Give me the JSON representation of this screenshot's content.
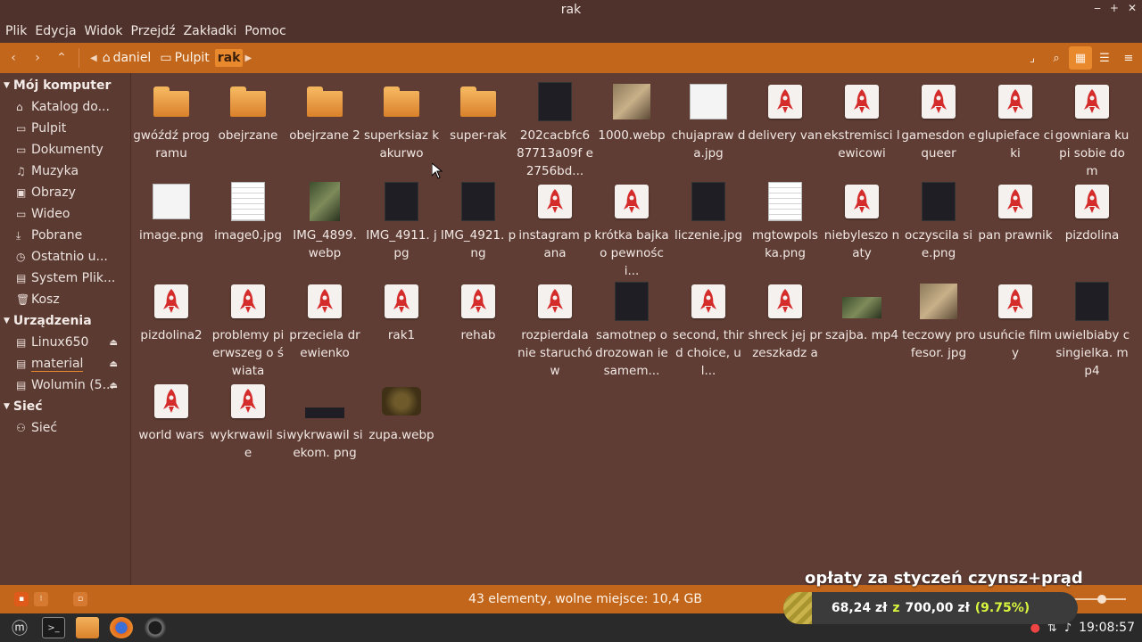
{
  "window": {
    "title": "rak"
  },
  "menu": [
    "Plik",
    "Edycja",
    "Widok",
    "Przejdź",
    "Zakładki",
    "Pomoc"
  ],
  "breadcrumb": [
    {
      "label": "daniel",
      "icon": "home-icon"
    },
    {
      "label": "Pulpit",
      "icon": "folder-icon"
    },
    {
      "label": "rak",
      "icon": ""
    }
  ],
  "sidebar": {
    "sections": [
      {
        "title": "Mój komputer",
        "items": [
          {
            "label": "Katalog do...",
            "icon": "home-icon"
          },
          {
            "label": "Pulpit",
            "icon": "folder-icon"
          },
          {
            "label": "Dokumenty",
            "icon": "folder-icon"
          },
          {
            "label": "Muzyka",
            "icon": "music-icon"
          },
          {
            "label": "Obrazy",
            "icon": "image-icon"
          },
          {
            "label": "Wideo",
            "icon": "folder-icon"
          },
          {
            "label": "Pobrane",
            "icon": "download-icon"
          },
          {
            "label": "Ostatnio u...",
            "icon": "clock-icon"
          },
          {
            "label": "System Plik...",
            "icon": "drive-icon"
          },
          {
            "label": "Kosz",
            "icon": "trash-icon"
          }
        ]
      },
      {
        "title": "Urządzenia",
        "items": [
          {
            "label": "Linux650",
            "icon": "drive-icon",
            "eject": true
          },
          {
            "label": "material",
            "icon": "drive-icon",
            "eject": true
          },
          {
            "label": "Wolumin (5...",
            "icon": "drive-icon",
            "eject": true
          }
        ]
      },
      {
        "title": "Sieć",
        "items": [
          {
            "label": "Sieć",
            "icon": "network-icon"
          }
        ]
      }
    ]
  },
  "files": [
    {
      "name": "gwóźdź programu",
      "kind": "folder"
    },
    {
      "name": "obejrzane",
      "kind": "folder"
    },
    {
      "name": "obejrzane 2",
      "kind": "folder"
    },
    {
      "name": "superksiaz kakurwo",
      "kind": "folder"
    },
    {
      "name": "super-rak",
      "kind": "folder"
    },
    {
      "name": "202cacbfc6 87713a09f e2756bd...",
      "kind": "image-dark"
    },
    {
      "name": "1000.webp",
      "kind": "image-photo"
    },
    {
      "name": "chujapraw da.jpg",
      "kind": "image-light"
    },
    {
      "name": "delivery van",
      "kind": "rocket"
    },
    {
      "name": "ekstremisci lewicowi",
      "kind": "rocket"
    },
    {
      "name": "gamesdon equeer",
      "kind": "rocket"
    },
    {
      "name": "glupieface ciki",
      "kind": "rocket"
    },
    {
      "name": "gowniara kupi sobie dom",
      "kind": "rocket"
    },
    {
      "name": "image.png",
      "kind": "image-light"
    },
    {
      "name": "image0.jpg",
      "kind": "image-doc"
    },
    {
      "name": "IMG_4899. webp",
      "kind": "image-green"
    },
    {
      "name": "IMG_4911. jpg",
      "kind": "image-dark"
    },
    {
      "name": "IMG_4921. png",
      "kind": "image-dark"
    },
    {
      "name": "instagram pana",
      "kind": "rocket"
    },
    {
      "name": "krótka bajka o pewności...",
      "kind": "rocket"
    },
    {
      "name": "liczenie.jpg",
      "kind": "image-dark"
    },
    {
      "name": "mgtowpols ka.png",
      "kind": "image-doc"
    },
    {
      "name": "niebyleszo naty",
      "kind": "rocket"
    },
    {
      "name": "oczyscila sie.png",
      "kind": "image-dark"
    },
    {
      "name": "pan prawnik",
      "kind": "rocket"
    },
    {
      "name": "pizdolina",
      "kind": "rocket"
    },
    {
      "name": "pizdolina2",
      "kind": "rocket"
    },
    {
      "name": "problemy pierwszeg o świata",
      "kind": "rocket"
    },
    {
      "name": "przeciela drewienko",
      "kind": "rocket"
    },
    {
      "name": "rak1",
      "kind": "rocket"
    },
    {
      "name": "rehab",
      "kind": "rocket"
    },
    {
      "name": "rozpierdala nie staruchów",
      "kind": "rocket"
    },
    {
      "name": "samotnep odrozowan iesamem...",
      "kind": "image-dark"
    },
    {
      "name": "second, third choice, ul...",
      "kind": "rocket"
    },
    {
      "name": "shreck jej przeszkadz a",
      "kind": "rocket"
    },
    {
      "name": "szajba. mp4",
      "kind": "video-green"
    },
    {
      "name": "teczowy profesor. jpg",
      "kind": "image-photo"
    },
    {
      "name": "usuńcie filmy",
      "kind": "rocket"
    },
    {
      "name": "uwielbiaby csingielka. mp4",
      "kind": "image-dark"
    },
    {
      "name": "world wars",
      "kind": "rocket"
    },
    {
      "name": "wykrwawil sie",
      "kind": "rocket"
    },
    {
      "name": "wykrwawil siekom. png",
      "kind": "image-strip"
    },
    {
      "name": "zupa.webp",
      "kind": "image-soup"
    }
  ],
  "status": {
    "text": "43 elementy, wolne miejsce: 10,4 GB"
  },
  "overlay": {
    "heading": "opłaty za styczeń czynsz+prąd",
    "current": "68,24 zł",
    "connector": "z",
    "goal": "700,00 zł",
    "percent_text": "(9.75%)",
    "progress": 0.0975
  },
  "taskbar": {
    "clock": "19:08:57"
  },
  "colors": {
    "accent": "#c2661b",
    "background": "#5f3d34",
    "active_crumb": "#e9892d"
  }
}
